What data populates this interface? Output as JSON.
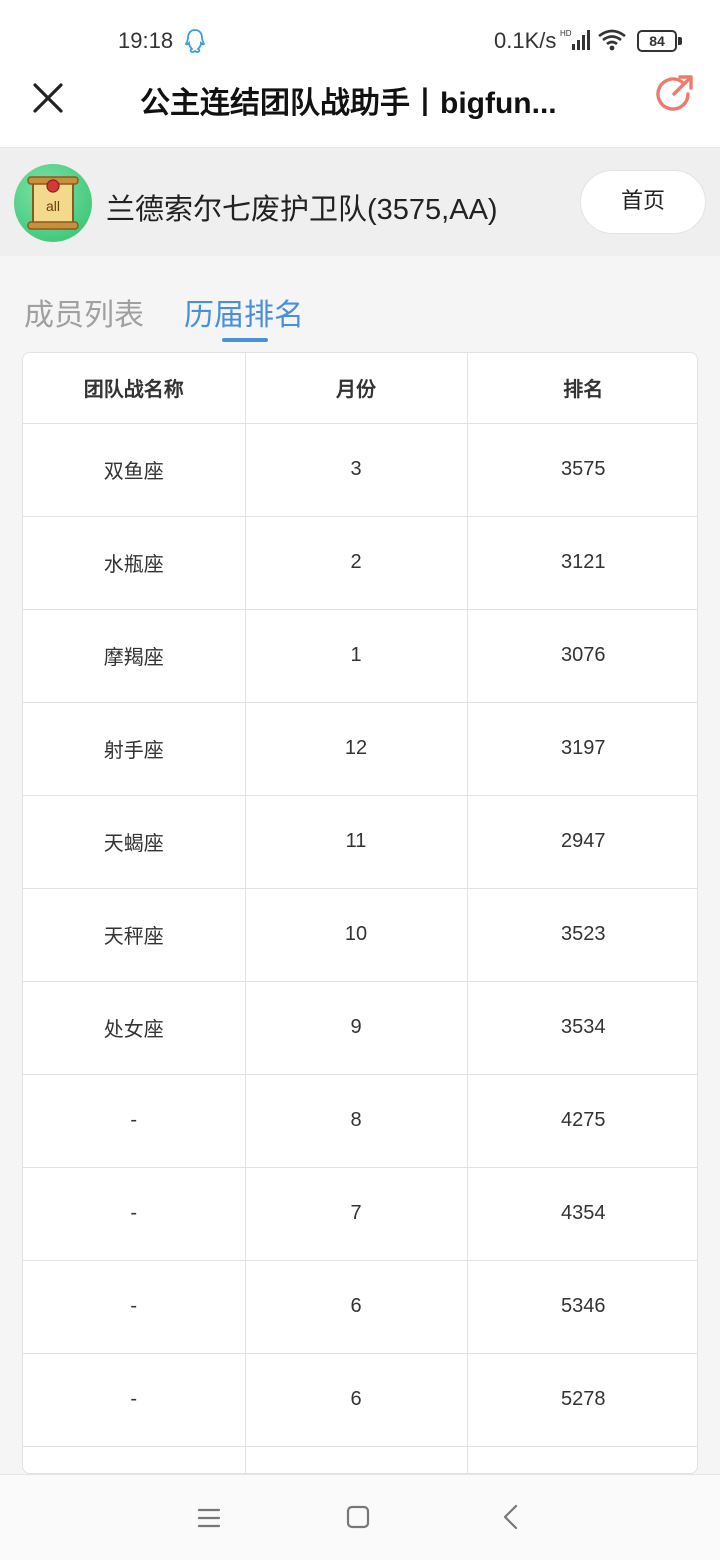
{
  "status_bar": {
    "time": "19:18",
    "net_speed": "0.1K/s",
    "battery": "84",
    "icons": [
      "qq-icon",
      "signal-icon",
      "wifi-icon",
      "battery-icon"
    ]
  },
  "title_bar": {
    "title": "公主连结团队战助手丨bigfun...",
    "icons": [
      "close-icon",
      "share-icon"
    ],
    "accent_color": "#ee7a6b"
  },
  "team": {
    "avatar_text": "all",
    "name": "兰德索尔七废护卫队(3575,AA)",
    "home_button": "首页"
  },
  "tabs": [
    {
      "label": "成员列表",
      "active": false
    },
    {
      "label": "历届排名",
      "active": true
    }
  ],
  "colors": {
    "active_tab": "#4a90d9",
    "inactive_tab": "#a0a0a0"
  },
  "table": {
    "headers": [
      "团队战名称",
      "月份",
      "排名"
    ],
    "rows": [
      [
        "双鱼座",
        "3",
        "3575"
      ],
      [
        "水瓶座",
        "2",
        "3121"
      ],
      [
        "摩羯座",
        "1",
        "3076"
      ],
      [
        "射手座",
        "12",
        "3197"
      ],
      [
        "天蝎座",
        "11",
        "2947"
      ],
      [
        "天秤座",
        "10",
        "3523"
      ],
      [
        "处女座",
        "9",
        "3534"
      ],
      [
        "-",
        "8",
        "4275"
      ],
      [
        "-",
        "7",
        "4354"
      ],
      [
        "-",
        "6",
        "5346"
      ],
      [
        "-",
        "6",
        "5278"
      ],
      [
        "",
        "",
        ""
      ]
    ]
  },
  "nav_bar": {
    "icons": [
      "menu-icon",
      "home-square-icon",
      "back-chevron-icon"
    ]
  }
}
